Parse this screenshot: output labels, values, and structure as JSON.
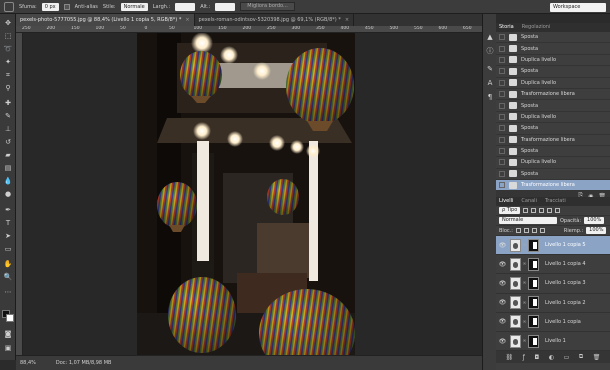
{
  "options_bar": {
    "feather_label": "Sfuma:",
    "feather_value": "0 px",
    "antialias_label": "Anti-alias",
    "style_label": "Stile:",
    "style_value": "Normale",
    "width_label": "Largh.:",
    "height_label": "Alt.:",
    "refine_edge_label": "Migliora bordo...",
    "workspace_label": "Workspace"
  },
  "doc_tabs": [
    {
      "title": "pexels-photo-5777055.jpg @ 88,4% (Livello 1 copia 5, RGB/8*) *",
      "close": "×"
    },
    {
      "title": "pexels-roman-odintsov-5320398.jpg @ 69,1% (RGB/8*) *",
      "close": "×"
    }
  ],
  "ruler_marks": [
    "250",
    "200",
    "150",
    "100",
    "50",
    "0",
    "50",
    "100",
    "150",
    "200",
    "250",
    "300",
    "350",
    "400",
    "450",
    "500",
    "550",
    "600",
    "650"
  ],
  "status": {
    "zoom": "88,4%",
    "doc": "Doc: 1,07 MB/8,98 MB"
  },
  "history_panel": {
    "tabs": [
      "Storia",
      "Regolazioni"
    ],
    "items": [
      {
        "label": "Sposta",
        "selected": false
      },
      {
        "label": "Sposta",
        "selected": false
      },
      {
        "label": "Duplica livello",
        "selected": false
      },
      {
        "label": "Sposta",
        "selected": false
      },
      {
        "label": "Duplica livello",
        "selected": false
      },
      {
        "label": "Trasformazione libera",
        "selected": false
      },
      {
        "label": "Sposta",
        "selected": false
      },
      {
        "label": "Duplica livello",
        "selected": false
      },
      {
        "label": "Sposta",
        "selected": false
      },
      {
        "label": "Trasformazione libera",
        "selected": false
      },
      {
        "label": "Sposta",
        "selected": false
      },
      {
        "label": "Duplica livello",
        "selected": false
      },
      {
        "label": "Sposta",
        "selected": false
      },
      {
        "label": "Trasformazione libera",
        "selected": true
      }
    ]
  },
  "layers_panel": {
    "tabs": [
      "Livelli",
      "Canali",
      "Tracciati"
    ],
    "kind_filter": "ρ Tipo",
    "blend_mode": "Normale",
    "opacity_label": "Opacità:",
    "opacity_value": "100%",
    "lock_label": "Bloc.:",
    "fill_label": "Riemp.:",
    "fill_value": "100%",
    "layers": [
      {
        "name": "Livello 1 copia 5",
        "selected": true
      },
      {
        "name": "Livello 1 copia 4",
        "selected": false
      },
      {
        "name": "Livello 1 copia 3",
        "selected": false
      },
      {
        "name": "Livello 1 copia 2",
        "selected": false
      },
      {
        "name": "Livello 1 copia",
        "selected": false
      },
      {
        "name": "Livello 1",
        "selected": false
      }
    ],
    "footer_icons": [
      "link-icon",
      "fx-icon",
      "mask-icon",
      "adjustment-icon",
      "folder-icon",
      "new-layer-icon",
      "trash-icon"
    ]
  },
  "colors": {
    "accent_selection": "#8ba4c6",
    "panel_bg": "#3e3e3e",
    "canvas_bg": "#282828"
  }
}
